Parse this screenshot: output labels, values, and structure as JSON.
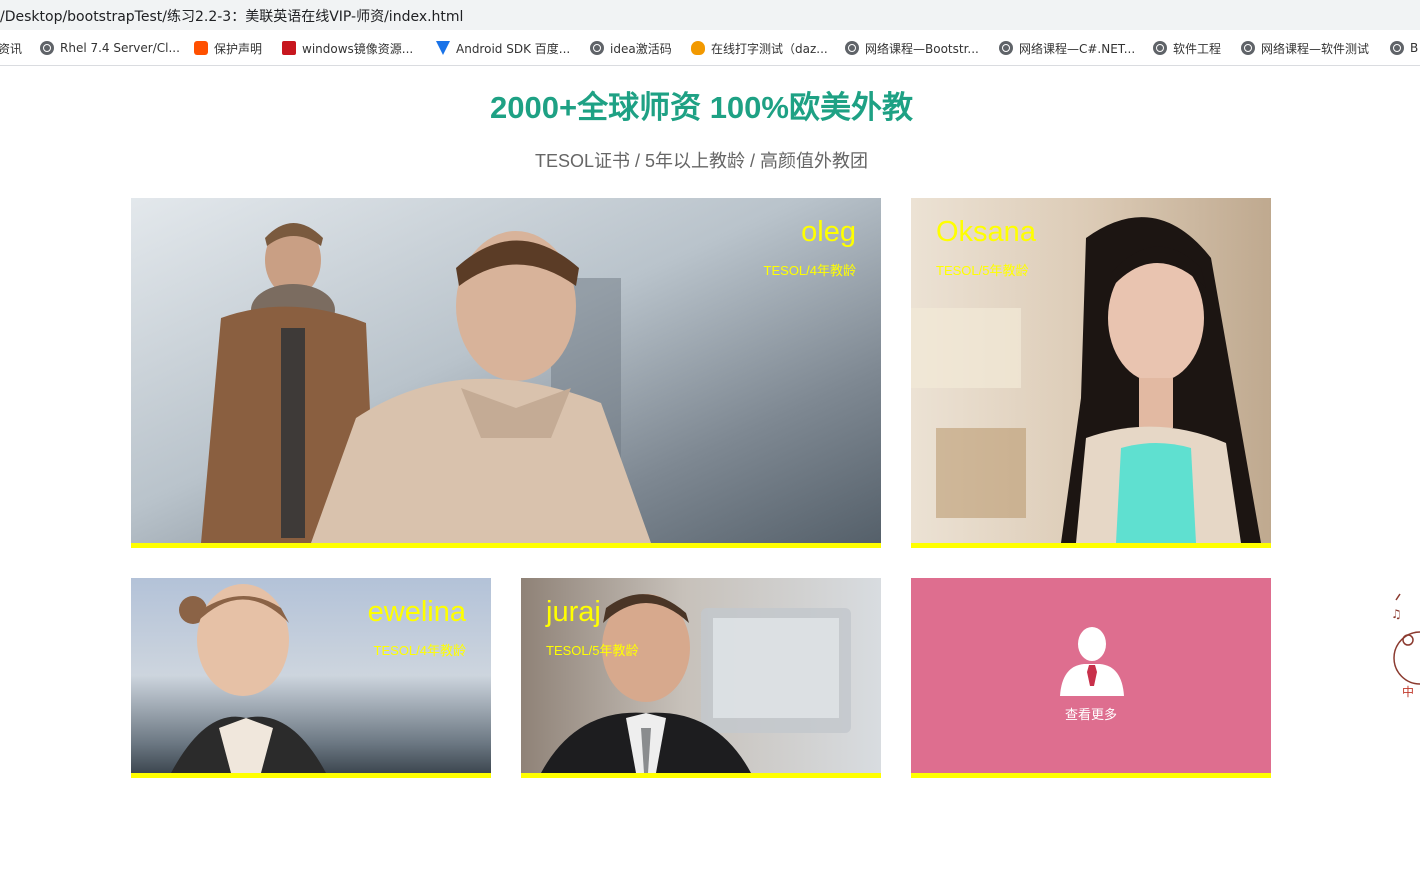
{
  "browser": {
    "url": "/Desktop/bootstrapTest/练习2.2-3：美联英语在线VIP-师资/index.html",
    "bookmarks": [
      {
        "label": "资讯",
        "icon": "none"
      },
      {
        "label": "Rhel 7.4 Server/Cl...",
        "icon": "globe-icon"
      },
      {
        "label": "保护声明",
        "icon": "taobao-icon"
      },
      {
        "label": "windows镜像资源...",
        "icon": "csdn-icon"
      },
      {
        "label": "Android SDK 百度...",
        "icon": "funnel-icon"
      },
      {
        "label": "idea激活码",
        "icon": "globe-icon"
      },
      {
        "label": "在线打字测试（daz...",
        "icon": "fire-icon"
      },
      {
        "label": "网络课程—Bootstr...",
        "icon": "globe-icon"
      },
      {
        "label": "网络课程—C#.NET...",
        "icon": "globe-icon"
      },
      {
        "label": "软件工程",
        "icon": "globe-icon"
      },
      {
        "label": "网络课程—软件测试",
        "icon": "globe-icon"
      },
      {
        "label": "B",
        "icon": "globe-icon"
      }
    ]
  },
  "section": {
    "title": "2000+全球师资 100%欧美外教",
    "subtitle": "TESOL证书 / 5年以上教龄 / 高颜值外教团"
  },
  "teachers": [
    {
      "name": "oleg",
      "meta": "TESOL/4年教龄"
    },
    {
      "name": "Oksana",
      "meta": "TESOL/5年教龄"
    },
    {
      "name": "ewelina",
      "meta": "TESOL/4年教龄"
    },
    {
      "name": "juraj",
      "meta": "TESOL/5年教龄"
    }
  ],
  "more_card": {
    "label": "查看更多",
    "background": "#de6e8f"
  },
  "colors": {
    "title": "#1ea184",
    "accent_yellow": "#ffff00",
    "subtitle": "#666666"
  }
}
